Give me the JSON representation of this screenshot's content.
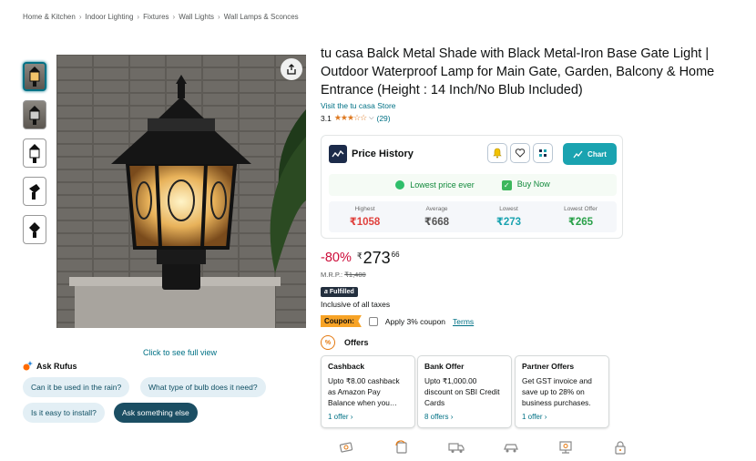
{
  "breadcrumb": [
    "Home & Kitchen",
    "Indoor Lighting",
    "Fixtures",
    "Wall Lights",
    "Wall Lamps & Sconces"
  ],
  "breadcrumb_separator": "›",
  "gallery": {
    "click_full_view": "Click to see full view"
  },
  "rufus": {
    "title": "Ask Rufus",
    "chips": [
      "Can it be used in the rain?",
      "What type of bulb does it need?",
      "Is it easy to install?"
    ],
    "ask_button": "Ask something else"
  },
  "product": {
    "title": "tu casa Balck Metal Shade with Black Metal-Iron Base Gate Light | Outdoor Waterproof Lamp for Main Gate, Garden, Balcony & Home Entrance (Height : 14 Inch/No Blub Included)",
    "store_link": "Visit the tu casa Store",
    "rating_value": "3.1",
    "rating_stars": 3.1,
    "rating_star_glyphs": "★★★☆☆",
    "rating_dropdown": "⌵",
    "rating_count": "(29)"
  },
  "price_history": {
    "title": "Price History",
    "chart_button": "Chart",
    "lowest_ever": "Lowest price ever",
    "buy_now": "Buy Now",
    "stats": [
      {
        "label": "Highest",
        "value": "₹1058",
        "color": "#e0413d"
      },
      {
        "label": "Average",
        "value": "₹668",
        "color": "#555555"
      },
      {
        "label": "Lowest",
        "value": "₹273",
        "color": "#1aa3b0"
      },
      {
        "label": "Lowest Offer",
        "value": "₹265",
        "color": "#2aa14a"
      }
    ]
  },
  "pricing": {
    "discount": "-80%",
    "currency": "₹",
    "price_whole": "273",
    "price_fraction": "66",
    "mrp_label": "M.R.P.:",
    "mrp_value": "₹1,400",
    "fulfilled_a": "a",
    "fulfilled_label": "Fulfilled",
    "taxes": "Inclusive of all taxes"
  },
  "coupon": {
    "tag": "Coupon:",
    "text": "Apply 3% coupon",
    "terms": "Terms"
  },
  "offers": {
    "title": "Offers",
    "icon_text": "%",
    "cards": [
      {
        "title": "Cashback",
        "desc": "Upto ₹8.00 cashback as Amazon Pay Balance when you…",
        "link": "1 offer ›"
      },
      {
        "title": "Bank Offer",
        "desc": "Upto ₹1,000.00 discount on SBI Credit Cards",
        "link": "8 offers ›"
      },
      {
        "title": "Partner Offers",
        "desc": "Get GST invoice and save up to 28% on business purchases.",
        "link": "1 offer ›"
      }
    ]
  },
  "feature_icons": [
    "cash-on-delivery-icon",
    "return-icon",
    "delivery-truck-icon",
    "free-delivery-icon",
    "top-brand-icon",
    "secure-transaction-icon"
  ],
  "colors": {
    "link": "#007185",
    "discount": "#cc0c39",
    "accent_teal": "#1aa3b0",
    "coupon": "#f7a326"
  }
}
